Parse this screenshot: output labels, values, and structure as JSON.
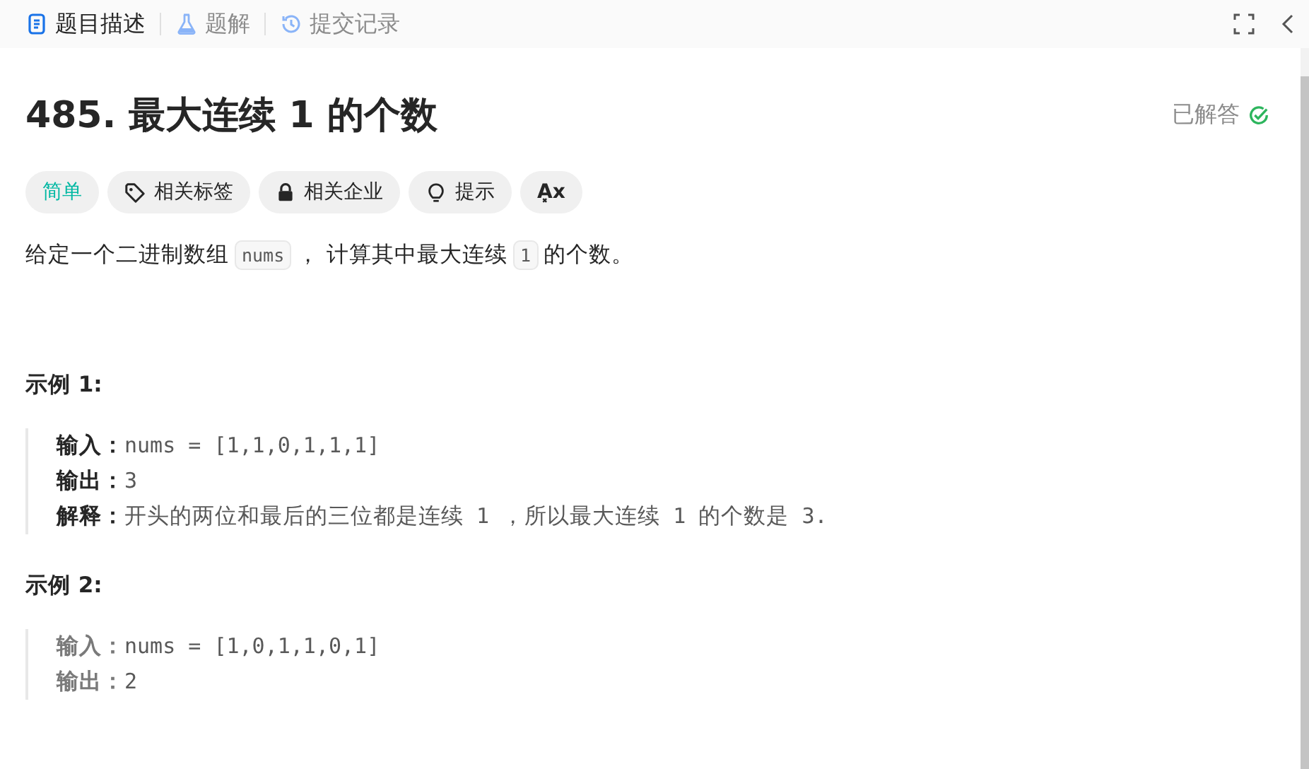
{
  "tabs": [
    {
      "label": "题目描述",
      "selected": true
    },
    {
      "label": "题解",
      "selected": false
    },
    {
      "label": "提交记录",
      "selected": false
    }
  ],
  "problem": {
    "title": "485. 最大连续 1 的个数",
    "status": "已解答",
    "solved": true
  },
  "chips": [
    {
      "kind": "difficulty",
      "label": "简单"
    },
    {
      "kind": "tag",
      "label": "相关标签"
    },
    {
      "kind": "lock",
      "label": "相关企业"
    },
    {
      "kind": "hint",
      "label": "提示"
    },
    {
      "kind": "translate",
      "label": "A͓x"
    }
  ],
  "description": [
    {
      "text": "给定一个二进制数组",
      "code": false
    },
    {
      "text": "nums",
      "code": true
    },
    {
      "text": "， 计算其中最大连续",
      "code": false
    },
    {
      "text": "1",
      "code": true
    },
    {
      "text": "的个数。",
      "code": false
    }
  ],
  "examples": [
    {
      "heading": "示例 1:",
      "emphasized": true,
      "lines": [
        {
          "label": "输入：",
          "parts": [
            {
              "text": "nums = [1,1,0,1,1,1]",
              "mono": true
            }
          ]
        },
        {
          "label": "输出：",
          "parts": [
            {
              "text": "3",
              "mono": true
            }
          ]
        },
        {
          "label": "解释：",
          "parts": [
            {
              "text": "开头的两位和最后的三位都是连续",
              "mono": false
            },
            {
              "text": " 1 ",
              "mono": true
            },
            {
              "text": "，所以最大连续",
              "mono": false
            },
            {
              "text": " 1 ",
              "mono": true
            },
            {
              "text": "的个数是",
              "mono": false
            },
            {
              "text": " 3.",
              "mono": true
            }
          ]
        }
      ]
    },
    {
      "heading": "示例 2:",
      "emphasized": false,
      "lines": [
        {
          "label": "输入：",
          "parts": [
            {
              "text": "nums = [1,0,1,1,0,1]",
              "mono": true
            }
          ]
        },
        {
          "label": "输出：",
          "parts": [
            {
              "text": "2",
              "mono": true
            }
          ]
        }
      ]
    }
  ]
}
